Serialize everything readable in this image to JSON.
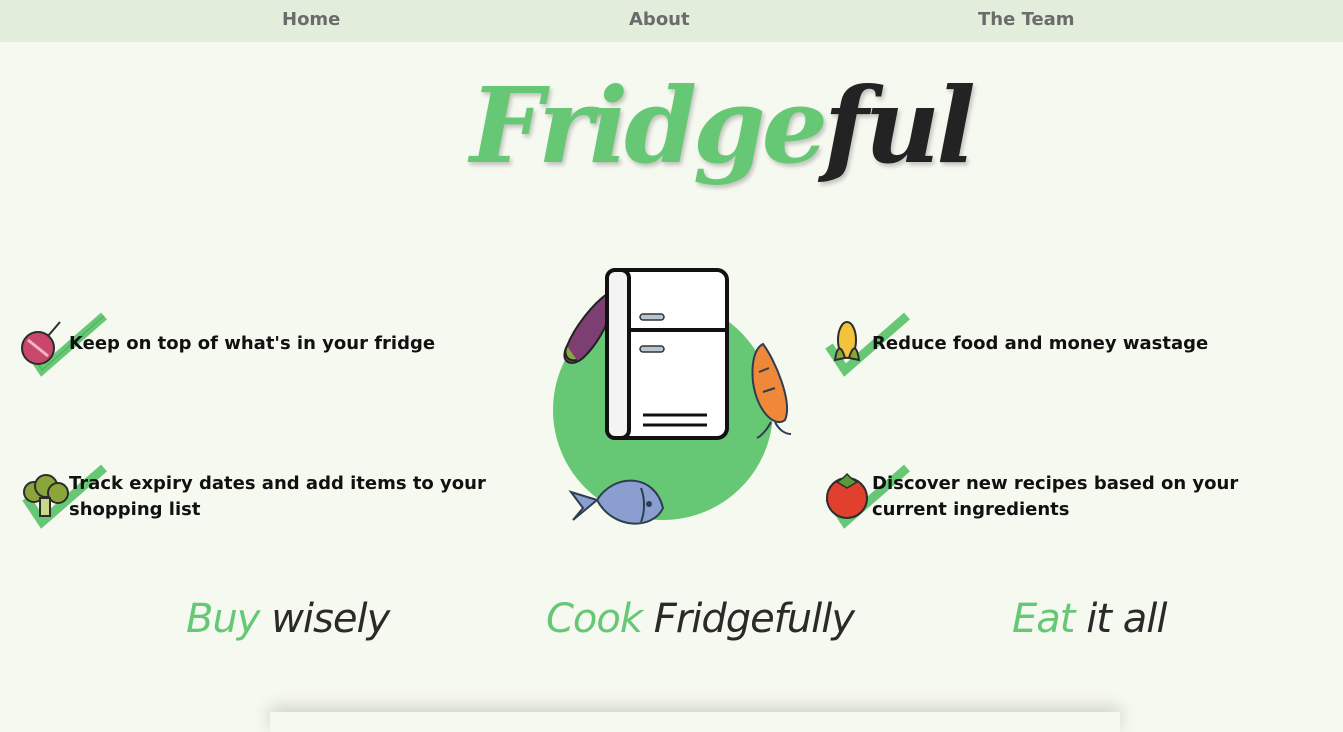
{
  "nav": {
    "home": "Home",
    "about": "About",
    "team": "The Team"
  },
  "logo": {
    "part1": "Fridge",
    "part2": "ful"
  },
  "features": {
    "top_left": "Keep on top of what's in your fridge",
    "bottom_left": "Track expiry dates and add items to your shopping list",
    "top_right": "Reduce food and money wastage",
    "bottom_right": "Discover new recipes based on your current ingredients"
  },
  "icons": {
    "top_left": "beetroot-check-icon",
    "bottom_left": "broccoli-check-icon",
    "top_right": "corn-check-icon",
    "bottom_right": "tomato-check-icon",
    "hero": "fridge-illustration"
  },
  "taglines": [
    {
      "accent": "Buy",
      "rest": "wisely"
    },
    {
      "accent": "Cook",
      "rest": "Fridgefully"
    },
    {
      "accent": "Eat",
      "rest": "it all"
    }
  ],
  "colors": {
    "accent": "#66c875",
    "background": "#f6f9f0",
    "nav": "#e2eddc"
  }
}
